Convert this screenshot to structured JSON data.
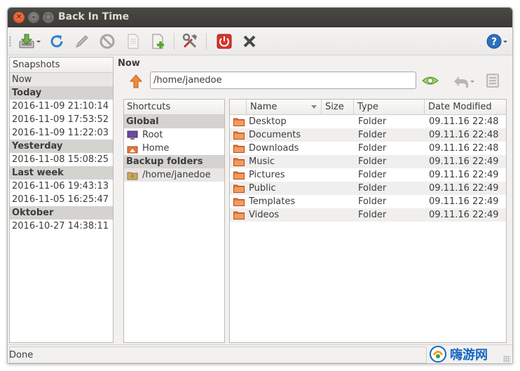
{
  "window": {
    "title": "Back In Time"
  },
  "toolbar": {
    "icons": [
      "take-snapshot-icon",
      "refresh-icon",
      "edit-icon",
      "remove-icon",
      "view-log-icon",
      "view-last-log-icon",
      "settings-icon",
      "shutdown-icon",
      "exit-icon",
      "help-icon"
    ]
  },
  "snapshots": {
    "header": "Snapshots",
    "rows": [
      {
        "label": "Now",
        "kind": "item",
        "selected": true
      },
      {
        "label": "Today",
        "kind": "group"
      },
      {
        "label": "2016-11-09 21:10:14",
        "kind": "item"
      },
      {
        "label": "2016-11-09 17:53:52",
        "kind": "item"
      },
      {
        "label": "2016-11-09 11:22:03",
        "kind": "item"
      },
      {
        "label": "Yesterday",
        "kind": "group"
      },
      {
        "label": "2016-11-08 15:08:25",
        "kind": "item"
      },
      {
        "label": "Last week",
        "kind": "group"
      },
      {
        "label": "2016-11-06 19:43:13",
        "kind": "item"
      },
      {
        "label": "2016-11-05 16:25:47",
        "kind": "item"
      },
      {
        "label": "Oktober",
        "kind": "group"
      },
      {
        "label": "2016-10-27 14:38:11",
        "kind": "item"
      }
    ]
  },
  "location": {
    "label": "Now",
    "path": "/home/janedoe"
  },
  "shortcuts": {
    "header": "Shortcuts",
    "rows": [
      {
        "label": "Global",
        "kind": "group"
      },
      {
        "label": "Root",
        "kind": "item",
        "icon": "computer-icon"
      },
      {
        "label": "Home",
        "kind": "item",
        "icon": "home-icon"
      },
      {
        "label": "Backup folders",
        "kind": "group"
      },
      {
        "label": "/home/janedoe",
        "kind": "item",
        "icon": "backup-folder-icon",
        "selected": true
      }
    ]
  },
  "files": {
    "columns": {
      "name": "Name",
      "size": "Size",
      "type": "Type",
      "date": "Date Modified"
    },
    "rows": [
      {
        "name": "Desktop",
        "size": "",
        "type": "Folder",
        "date": "09.11.16 22:48"
      },
      {
        "name": "Documents",
        "size": "",
        "type": "Folder",
        "date": "09.11.16 22:48"
      },
      {
        "name": "Downloads",
        "size": "",
        "type": "Folder",
        "date": "09.11.16 22:48"
      },
      {
        "name": "Music",
        "size": "",
        "type": "Folder",
        "date": "09.11.16 22:49"
      },
      {
        "name": "Pictures",
        "size": "",
        "type": "Folder",
        "date": "09.11.16 22:49"
      },
      {
        "name": "Public",
        "size": "",
        "type": "Folder",
        "date": "09.11.16 22:49"
      },
      {
        "name": "Templates",
        "size": "",
        "type": "Folder",
        "date": "09.11.16 22:49"
      },
      {
        "name": "Videos",
        "size": "",
        "type": "Folder",
        "date": "09.11.16 22:49"
      }
    ]
  },
  "status": {
    "text": "Done"
  },
  "watermark": {
    "text": "嗨游网"
  },
  "colors": {
    "titlebar": "#3b3a37",
    "group_row": "#d5d3d0",
    "folder": "#e8733a",
    "close_button": "#e05a2b"
  }
}
